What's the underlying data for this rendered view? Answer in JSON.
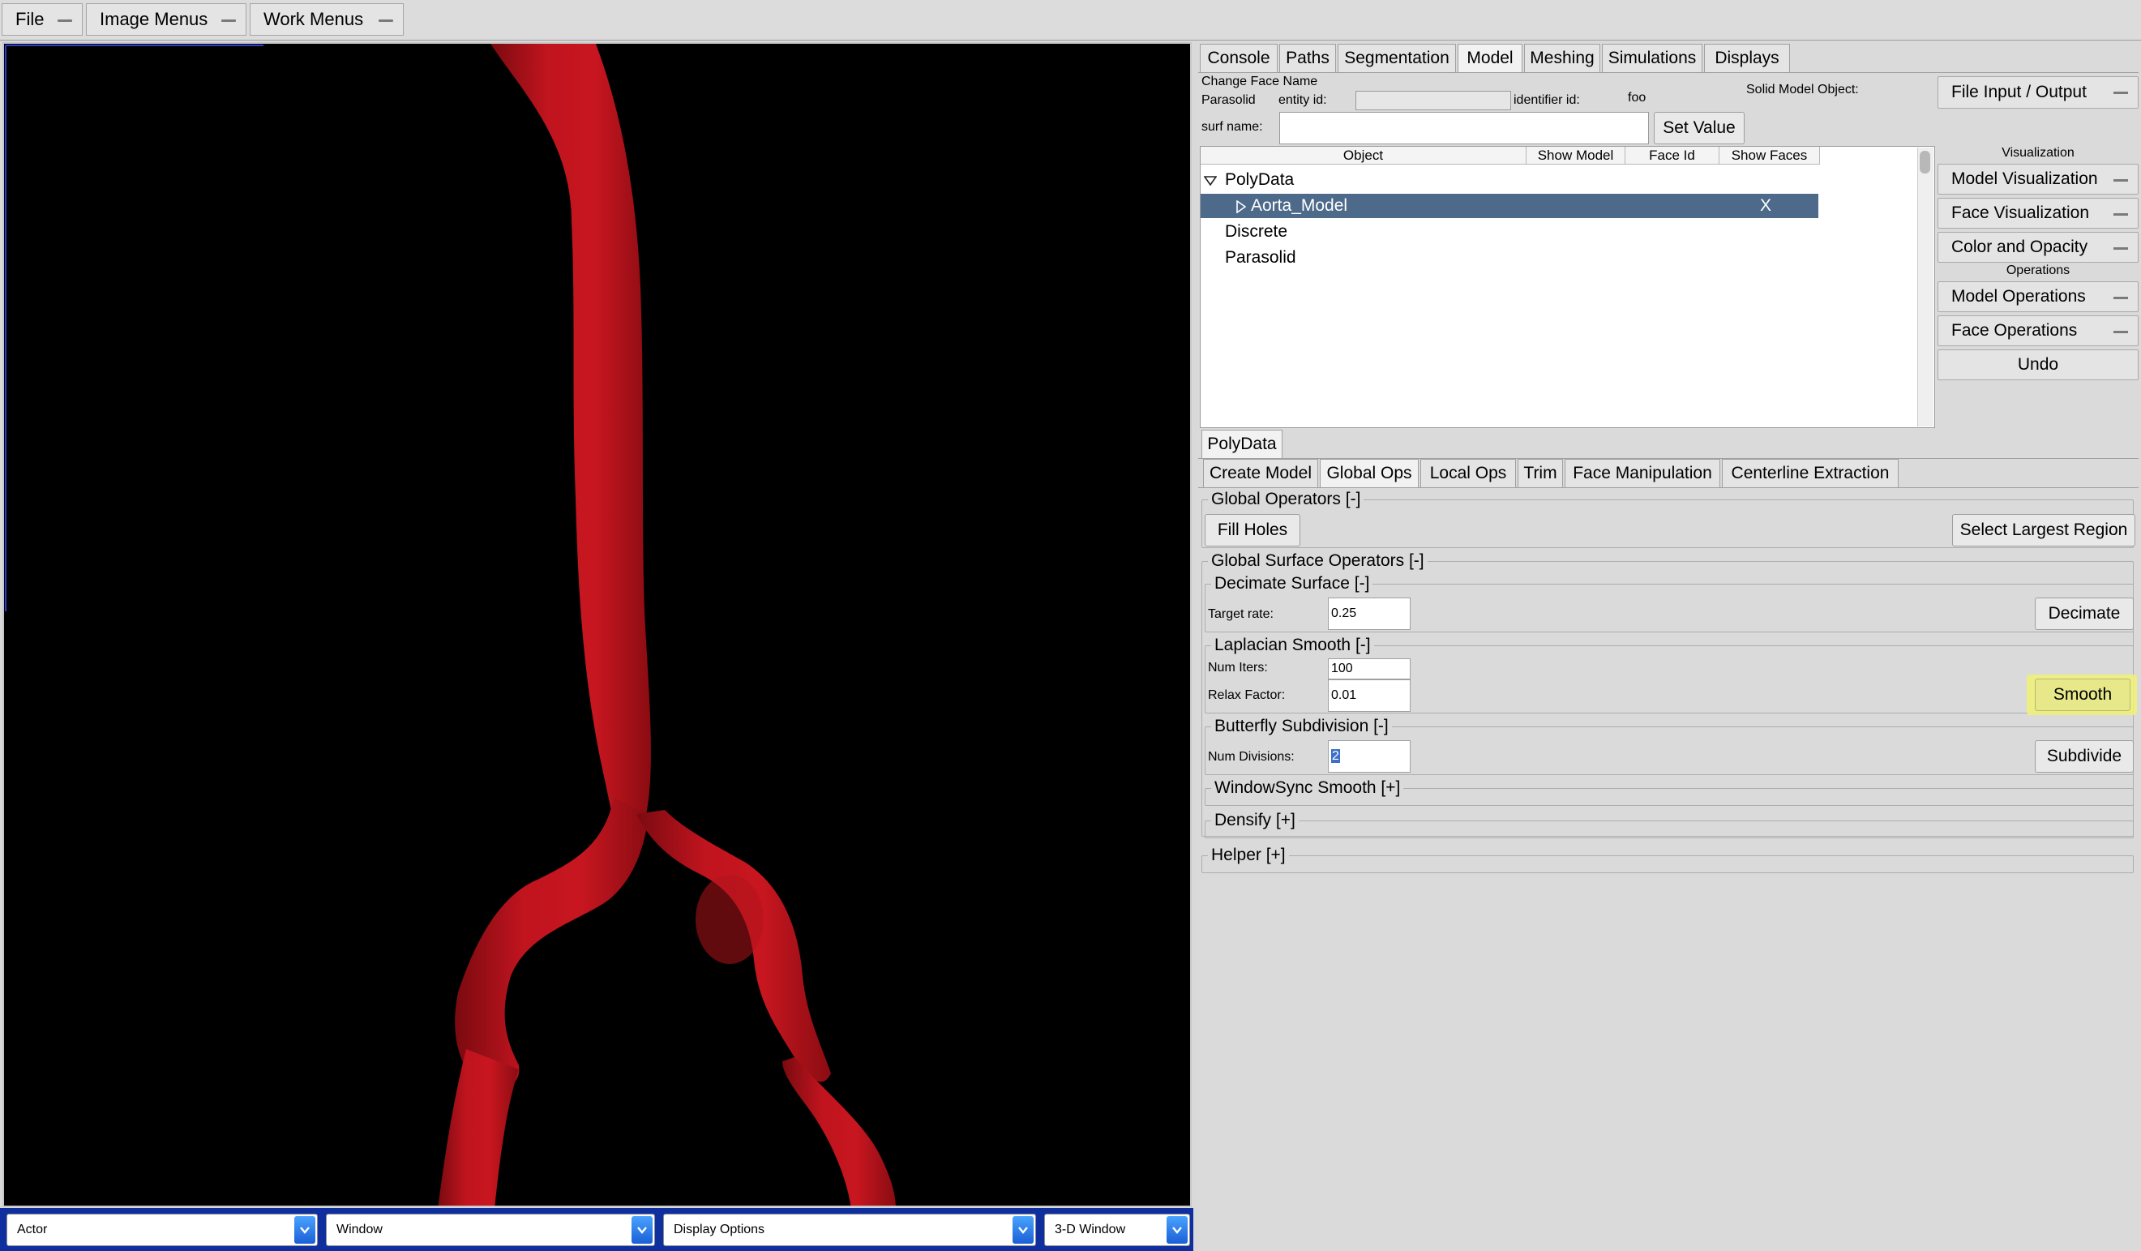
{
  "menubar": {
    "file": "File",
    "image_menus": "Image Menus",
    "work_menus": "Work Menus"
  },
  "viewport": {
    "background": "#000000",
    "vessel_color": "#b0141c"
  },
  "bottom_bar": {
    "actor": "Actor",
    "window": "Window",
    "display_options": "Display Options",
    "view_mode": "3-D Window"
  },
  "main_tabs": [
    "Console",
    "Paths",
    "Segmentation",
    "Model",
    "Meshing",
    "Simulations",
    "Displays"
  ],
  "active_main_tab": "Model",
  "face_name": {
    "title": "Change Face Name",
    "parasolid_label": "Parasolid",
    "entity_id_label": "entity id:",
    "entity_id_value": "",
    "identifier_id_label": "identifier id:",
    "identifier_id_value": "foo",
    "solid_model_object_label": "Solid Model Object:",
    "surf_name_label": "surf name:",
    "surf_name_value": "",
    "set_value_button": "Set Value"
  },
  "file_io_button": "File Input / Output",
  "tree": {
    "columns": [
      "Object",
      "Show Model",
      "Face Id",
      "Show Faces"
    ],
    "rows": [
      {
        "label": "PolyData",
        "expanded": true,
        "level": 0
      },
      {
        "label": "Aorta_Model",
        "level": 1,
        "selected": true,
        "show_faces": "X"
      },
      {
        "label": "Discrete",
        "level": 0
      },
      {
        "label": "Parasolid",
        "level": 0
      }
    ]
  },
  "side_panel": {
    "visualization_header": "Visualization",
    "model_visualization": "Model Visualization",
    "face_visualization": "Face Visualization",
    "color_and_opacity": "Color and Opacity",
    "operations_header": "Operations",
    "model_operations": "Model Operations",
    "face_operations": "Face Operations",
    "undo": "Undo"
  },
  "polydata_tab": "PolyData",
  "sub_tabs": [
    "Create Model",
    "Global Ops",
    "Local Ops",
    "Trim",
    "Face Manipulation",
    "Centerline Extraction"
  ],
  "active_sub_tab": "Global Ops",
  "global_ops": {
    "global_operators_title": "Global Operators [-]",
    "fill_holes": "Fill Holes",
    "select_largest_region": "Select Largest Region",
    "global_surface_operators_title": "Global Surface Operators [-]",
    "decimate_title": "Decimate Surface [-]",
    "target_rate_label": "Target rate:",
    "target_rate_value": "0.25",
    "decimate_button": "Decimate",
    "laplacian_title": "Laplacian Smooth [-]",
    "num_iters_label": "Num Iters:",
    "num_iters_value": "100",
    "relax_factor_label": "Relax Factor:",
    "relax_factor_value": "0.01",
    "smooth_button": "Smooth",
    "butterfly_title": "Butterfly Subdivision [-]",
    "num_divisions_label": "Num Divisions:",
    "num_divisions_value": "2",
    "subdivide_button": "Subdivide",
    "windowsync_title": "WindowSync Smooth [+]",
    "densify_title": "Densify [+]",
    "helper_title": "Helper [+]"
  },
  "colors": {
    "selected_row": "#4d6a8a",
    "highlight": "#eef07a"
  }
}
